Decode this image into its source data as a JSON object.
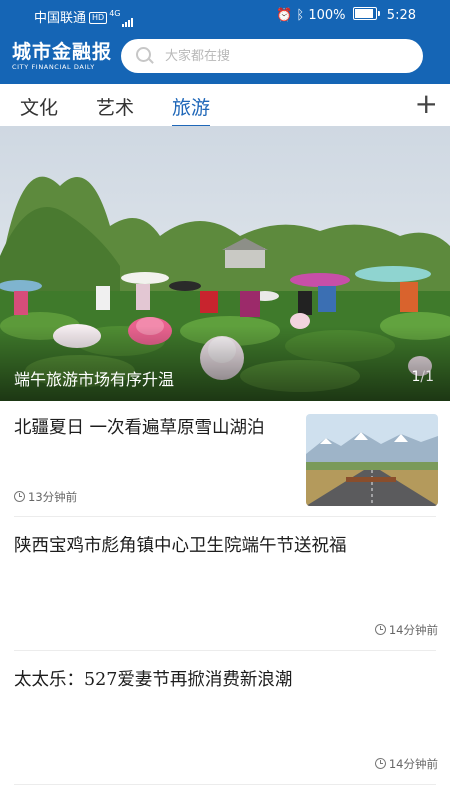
{
  "status_bar": {
    "carrier": "中国联通",
    "hd": "HD",
    "network": "4G",
    "battery": "100%",
    "battery_level": 1.0,
    "time": "5:28"
  },
  "header": {
    "logo_cn": "城市金融报",
    "logo_en": "CITY FINANCIAL DAILY",
    "search_placeholder": "大家都在搜"
  },
  "tabs": [
    {
      "label": "文化"
    },
    {
      "label": "艺术"
    },
    {
      "label": "旅游",
      "active": true
    }
  ],
  "add_tab_icon": "plus-icon",
  "hero": {
    "caption": "端午旅游市场有序升温",
    "current": "1",
    "separator": "/",
    "total": "1"
  },
  "news": [
    {
      "title": "北疆夏日 一次看遍草原雪山湖泊",
      "time": "13分钟前",
      "has_image": true
    },
    {
      "title": "陕西宝鸡市彪角镇中心卫生院端午节送祝福",
      "time": "14分钟前"
    },
    {
      "title": "太太乐：527爱妻节再掀消费新浪潮",
      "time": "14分钟前"
    }
  ],
  "colors": {
    "brand_blue": "#1565b5",
    "active_tab": "#1f67b8"
  }
}
